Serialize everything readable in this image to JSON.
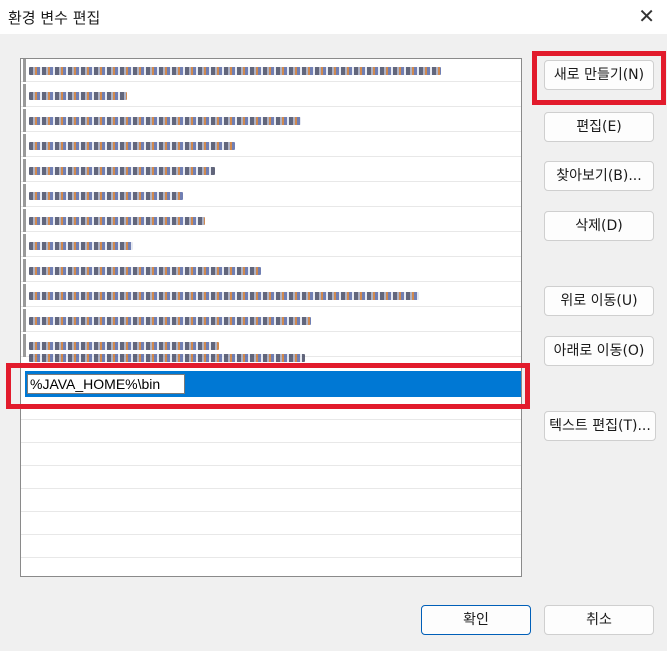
{
  "window": {
    "title": "환경 변수 편집",
    "close_glyph": "✕"
  },
  "list": {
    "selected_value": "%JAVA_HOME%\\bin",
    "blurred_row_count": 12,
    "empty_row_count": 9
  },
  "buttons": {
    "new": "새로 만들기(N)",
    "edit": "편집(E)",
    "browse": "찾아보기(B)...",
    "delete": "삭제(D)",
    "move_up": "위로 이동(U)",
    "move_down": "아래로 이동(O)",
    "edit_text": "텍스트 편집(T)...",
    "ok": "확인",
    "cancel": "취소"
  },
  "colors": {
    "selection": "#0078d4",
    "annotation": "#e21b2c",
    "background": "#f0f0f0"
  }
}
